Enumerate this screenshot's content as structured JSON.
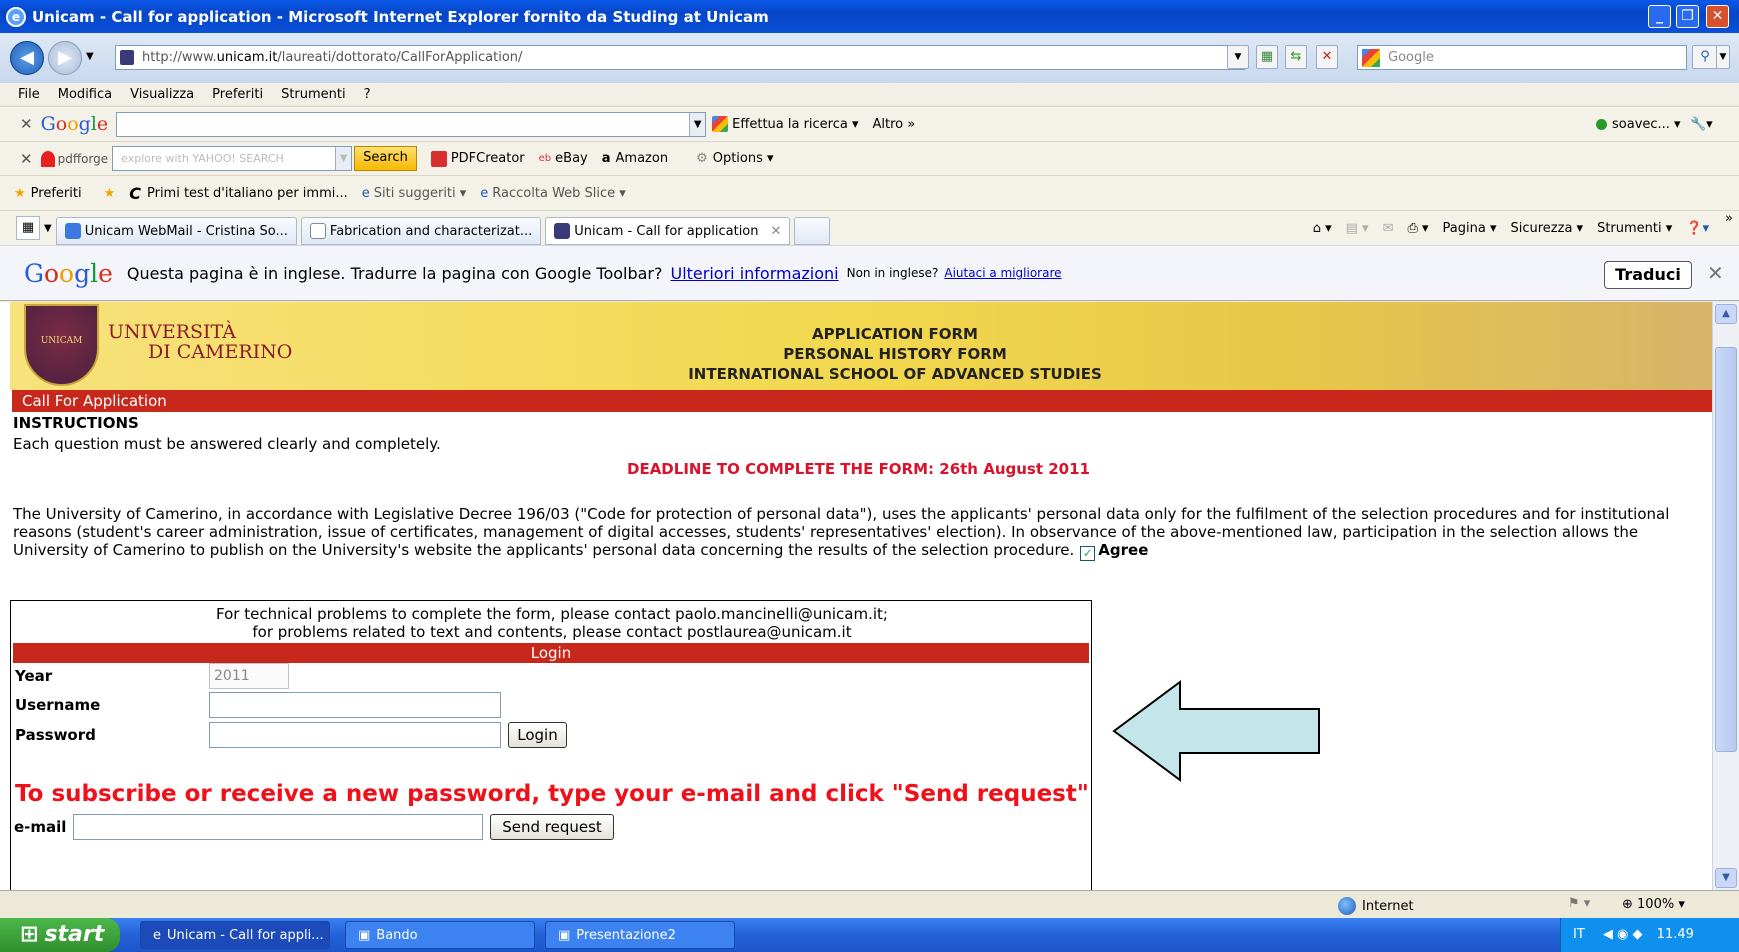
{
  "window": {
    "title": "Unicam - Call for application - Microsoft Internet Explorer fornito da Studing at Unicam"
  },
  "address": {
    "url_prefix": "http://www.",
    "url_domain": "unicam.it",
    "url_path": "/laureati/dottorato/CallForApplication/",
    "search_placeholder": "Google"
  },
  "menu": [
    "File",
    "Modifica",
    "Visualizza",
    "Preferiti",
    "Strumenti",
    "?"
  ],
  "google_toolbar": {
    "logo": "Google",
    "search_label": "Effettua la ricerca ▾",
    "more": "Altro »",
    "account": "soavec... ▾"
  },
  "yahoo_toolbar": {
    "pdfforge": "pdfforge",
    "placeholder": "explore with YAHOO! SEARCH",
    "search_button": "Search",
    "pdfcreator": "PDFCreator",
    "ebay": "eBay",
    "amazon": "Amazon",
    "options": "Options ▾"
  },
  "favorites_bar": {
    "favorites": "Preferiti",
    "item1": "Primi test d'italiano per immi...",
    "item2": "Siti suggeriti ▾",
    "item3": "Raccolta Web Slice ▾"
  },
  "tabs": [
    {
      "label": "Unicam WebMail - Cristina So..."
    },
    {
      "label": "Fabrication and characterizat..."
    },
    {
      "label": "Unicam - Call for application"
    }
  ],
  "command_bar": {
    "page": "Pagina ▾",
    "security": "Sicurezza ▾",
    "tools": "Strumenti ▾"
  },
  "translate_bar": {
    "logo": "Google",
    "message": "Questa pagina è in inglese. Tradurre la pagina con Google Toolbar?",
    "more_info": "Ulteriori informazioni",
    "not_english": "Non in inglese?",
    "help": "Aiutaci a migliorare",
    "translate_button": "Traduci"
  },
  "banner": {
    "line1": "APPLICATION FORM",
    "line2": "PERSONAL HISTORY FORM",
    "line3": "INTERNATIONAL SCHOOL OF ADVANCED STUDIES",
    "uni_line1": "UNIVERSITÀ",
    "uni_line2": "DI CAMERINO",
    "crest_text": "UNICAM"
  },
  "page": {
    "section": "Call For Application",
    "instructions_title": "INSTRUCTIONS",
    "instructions_text": "Each question must be answered clearly and completely.",
    "deadline": "DEADLINE TO COMPLETE THE FORM: 26th August 2011",
    "privacy": "The University of Camerino, in accordance with Legislative Decree 196/03 (\"Code for protection of personal data\"), uses the applicants' personal data only for the fulfilment of the selection procedures and for institutional reasons (student's career administration, issue of certificates, management of digital accesses, students' representatives' election). In observance of the above-mentioned law, participation in the selection allows the University of Camerino to publish on the University's website the applicants' personal data concerning the results of the selection procedure.",
    "agree": "Agree",
    "contact1": "For technical problems to complete the form, please contact paolo.mancinelli@unicam.it;",
    "contact2": "for problems related to text and contents, please contact postlaurea@unicam.it",
    "login_header": "Login",
    "year_label": "Year",
    "year_value": "2011",
    "username_label": "Username",
    "password_label": "Password",
    "login_button": "Login",
    "subscribe": "To subscribe or receive a new password, type your e-mail and click \"Send request\"",
    "email_label": "e-mail",
    "send_button": "Send request"
  },
  "status": {
    "zone": "Internet",
    "zoom": "100%"
  },
  "taskbar": {
    "start": "start",
    "tasks": [
      "Unicam - Call for appli...",
      "Bando",
      "Presentazione2"
    ],
    "lang": "IT",
    "time": "11.49"
  }
}
